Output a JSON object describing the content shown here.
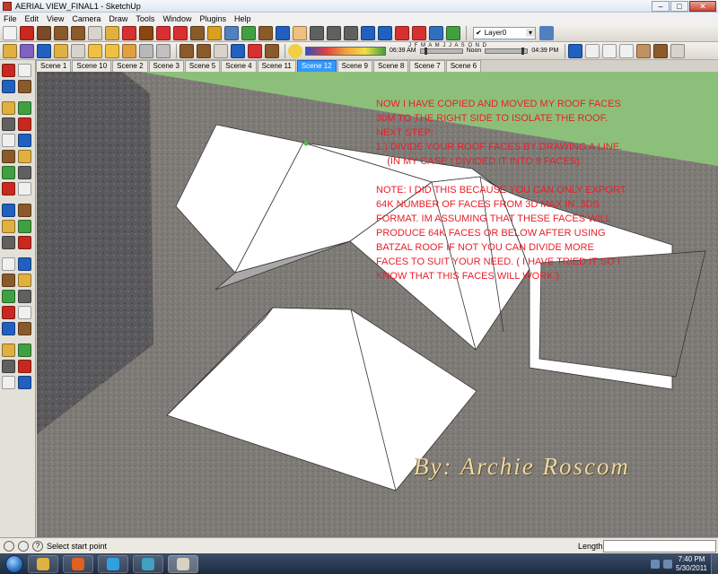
{
  "window": {
    "title": "AERIAL VIEW_FINAL1 - SketchUp",
    "controls": {
      "minimize": "–",
      "maximize": "□",
      "close": "✕"
    }
  },
  "menu": [
    "File",
    "Edit",
    "View",
    "Camera",
    "Draw",
    "Tools",
    "Window",
    "Plugins",
    "Help"
  ],
  "toolbar_top": {
    "icons": [
      {
        "name": "select-arrow-icon",
        "color": "#f2f2f2"
      },
      {
        "name": "line-pencil-icon",
        "color": "#c8281e"
      },
      {
        "name": "freehand-icon",
        "color": "#7a4a2a"
      },
      {
        "name": "rectangle-icon",
        "color": "#8b5a2b"
      },
      {
        "name": "circle-icon",
        "color": "#8b5a2b"
      },
      {
        "name": "arc-icon",
        "color": "#d8d4cc"
      },
      {
        "name": "pushpull-icon",
        "color": "#e0b040"
      },
      {
        "name": "rotate-icon",
        "color": "#d83030"
      },
      {
        "name": "followme-icon",
        "color": "#8b4513"
      },
      {
        "name": "scale-icon",
        "color": "#d83030"
      },
      {
        "name": "move-icon",
        "color": "#d83030"
      },
      {
        "name": "offset-icon",
        "color": "#8b5a2b"
      },
      {
        "name": "tape-measure-icon",
        "color": "#d8a020"
      },
      {
        "name": "text-icon",
        "color": "#5080c0"
      },
      {
        "name": "axes-icon",
        "color": "#40a040"
      },
      {
        "name": "3d-text-icon",
        "color": "#8b5a2b"
      },
      {
        "name": "orbit-icon",
        "color": "#2060c0"
      },
      {
        "name": "pan-icon",
        "color": "#f0c080"
      },
      {
        "name": "zoom-icon",
        "color": "#606060"
      },
      {
        "name": "zoom-window-icon",
        "color": "#606060"
      },
      {
        "name": "zoom-extents-icon",
        "color": "#606060"
      },
      {
        "name": "previous-view-icon",
        "color": "#2060c0"
      },
      {
        "name": "next-view-icon",
        "color": "#2060c0"
      },
      {
        "name": "get-models-icon",
        "color": "#d83030"
      },
      {
        "name": "share-model-icon",
        "color": "#d83030"
      },
      {
        "name": "google-earth-icon",
        "color": "#3070c0"
      },
      {
        "name": "add-location-icon",
        "color": "#40a040"
      }
    ],
    "layer": {
      "check": "✔",
      "value": "Layer0",
      "dropdown": "▾"
    },
    "layer_manager_icon": "layers-icon"
  },
  "toolbar_second": {
    "icons_left": [
      {
        "name": "make-component-icon",
        "color": "#e0b040"
      },
      {
        "name": "paint-bucket-icon",
        "color": "#8060c0"
      },
      {
        "name": "eraser-icon",
        "color": "#2060c0"
      },
      {
        "name": "look-around-icon",
        "color": "#e0b040"
      },
      {
        "name": "walk-icon",
        "color": "#d8d4cc"
      },
      {
        "name": "position-camera-icon",
        "color": "#f0c040"
      },
      {
        "name": "section-plane-icon",
        "color": "#f0c040"
      },
      {
        "name": "protractor-icon",
        "color": "#e0a040"
      },
      {
        "name": "dimension-icon",
        "color": "#b8b8b8"
      },
      {
        "name": "sandbox-icon",
        "color": "#c0c0c0"
      }
    ],
    "styles_icons": [
      {
        "name": "xray-icon",
        "color": "#8b5a2b"
      },
      {
        "name": "wireframe-icon",
        "color": "#8b5a2b"
      },
      {
        "name": "hidden-line-icon",
        "color": "#d8d4cc"
      },
      {
        "name": "shaded-icon",
        "color": "#2060c0"
      },
      {
        "name": "shaded-textures-icon",
        "color": "#d83030"
      },
      {
        "name": "monochrome-icon",
        "color": "#8b5a2b"
      }
    ],
    "shadow_toggle_icon": "sun-icon",
    "months": "J F M A M J J A S O N D",
    "time_start": "06:39 AM",
    "time_mid": "Noon",
    "time_end": "04:39 PM",
    "views_icons": [
      {
        "name": "iso-view-icon",
        "color": "#2060c0"
      },
      {
        "name": "top-view-icon",
        "color": "#f0f0f0"
      },
      {
        "name": "front-view-icon",
        "color": "#f0f0f0"
      },
      {
        "name": "right-view-icon",
        "color": "#f0f0f0"
      },
      {
        "name": "back-view-icon",
        "color": "#c09060"
      },
      {
        "name": "left-view-icon",
        "color": "#8b5a2b"
      },
      {
        "name": "perspective-icon",
        "color": "#d8d4cc"
      }
    ]
  },
  "scene_tabs": [
    {
      "label": "Scene 1",
      "active": false
    },
    {
      "label": "Scene 10",
      "active": false
    },
    {
      "label": "Scene 2",
      "active": false
    },
    {
      "label": "Scene 3",
      "active": false
    },
    {
      "label": "Scene 5",
      "active": false
    },
    {
      "label": "Scene 4",
      "active": false
    },
    {
      "label": "Scene 11",
      "active": false
    },
    {
      "label": "Scene 12",
      "active": true
    },
    {
      "label": "Scene 9",
      "active": false
    },
    {
      "label": "Scene 8",
      "active": false
    },
    {
      "label": "Scene 7",
      "active": false
    },
    {
      "label": "Scene 6",
      "active": false
    }
  ],
  "left_toolbar": [
    [
      "select-icon",
      "eraser-icon"
    ],
    [
      "paint-bucket-icon",
      "eraser-pink-icon"
    ],
    [
      "rectangle-icon",
      "line-icon"
    ],
    [
      "circle-icon",
      "arc-icon"
    ],
    [
      "polygon-icon",
      "freehand-icon"
    ],
    [
      "move-icon",
      "pushpull-icon"
    ],
    [
      "rotate-icon",
      "followme-icon"
    ],
    [
      "scale-icon",
      "offset-icon"
    ],
    [
      "tape-measure-icon",
      "dimension-icon"
    ],
    [
      "protractor-icon",
      "text-icon"
    ],
    [
      "axes-icon",
      "3d-text-icon"
    ],
    [
      "orbit-icon",
      "pan-icon"
    ],
    [
      "zoom-icon",
      "zoom-window-icon"
    ],
    [
      "zoom-extents-icon",
      "previous-icon"
    ],
    [
      "position-camera-icon",
      "look-around-icon"
    ],
    [
      "walk-icon",
      "section-plane-icon"
    ],
    [
      "get-models-icon",
      "share-model-icon"
    ],
    [
      "share-component-icon",
      "earth-icon"
    ],
    [
      "photo-textures-icon",
      "building-maker-icon"
    ]
  ],
  "annotation": {
    "lines": [
      "NOW I HAVE COPIED AND MOVED MY ROOF FACES",
      "30M TO THE RIGHT SIDE TO ISOLATE THE ROOF.",
      "NEXT STEP:",
      "1.) DIVIDE YOUR ROOF FACES BY DRAWING A LINE.",
      "    (IN MY CASE I DIVIDED IT INTO 9 FACES).",
      "",
      "NOTE: I DID THIS BECAUSE YOU CAN ONLY EXPORT",
      "64K NUMBER OF FACES FROM 3D MAX IN .3DS",
      "FORMAT. IM ASSUMING THAT THESE FACES WILL",
      "PRODUCE 64K FACES OR BELOW AFTER USING",
      "BATZAL ROOF IF NOT YOU CAN DIVIDE MORE",
      "FACES TO SUIT YOUR NEED. ( I HAVE TRIED IT SO I",
      "KNOW THAT THIS FACES WILL WORK.)"
    ],
    "color": "#e8202a"
  },
  "signature": "By: Archie Roscom",
  "status": {
    "text": "Select start point",
    "length_label": "Length",
    "length_value": ""
  },
  "taskbar": {
    "apps": [
      {
        "name": "explorer-taskbar-icon",
        "color": "#e0b040"
      },
      {
        "name": "firefox-taskbar-icon",
        "color": "#e06020"
      },
      {
        "name": "skype-taskbar-icon",
        "color": "#30a0e0"
      },
      {
        "name": "media-taskbar-icon",
        "color": "#40a0c0"
      },
      {
        "name": "sketchup-taskbar-icon",
        "color": "#d8d0c0"
      }
    ],
    "time": "7:40 PM",
    "date": "5/30/2011"
  },
  "colors": {
    "ground": "#7f7c78",
    "grass": "#8cc07a",
    "face": "#ffffff",
    "face_back": "#a8a8a8",
    "annotation": "#e8202a",
    "active_tab": "#3399ff"
  }
}
